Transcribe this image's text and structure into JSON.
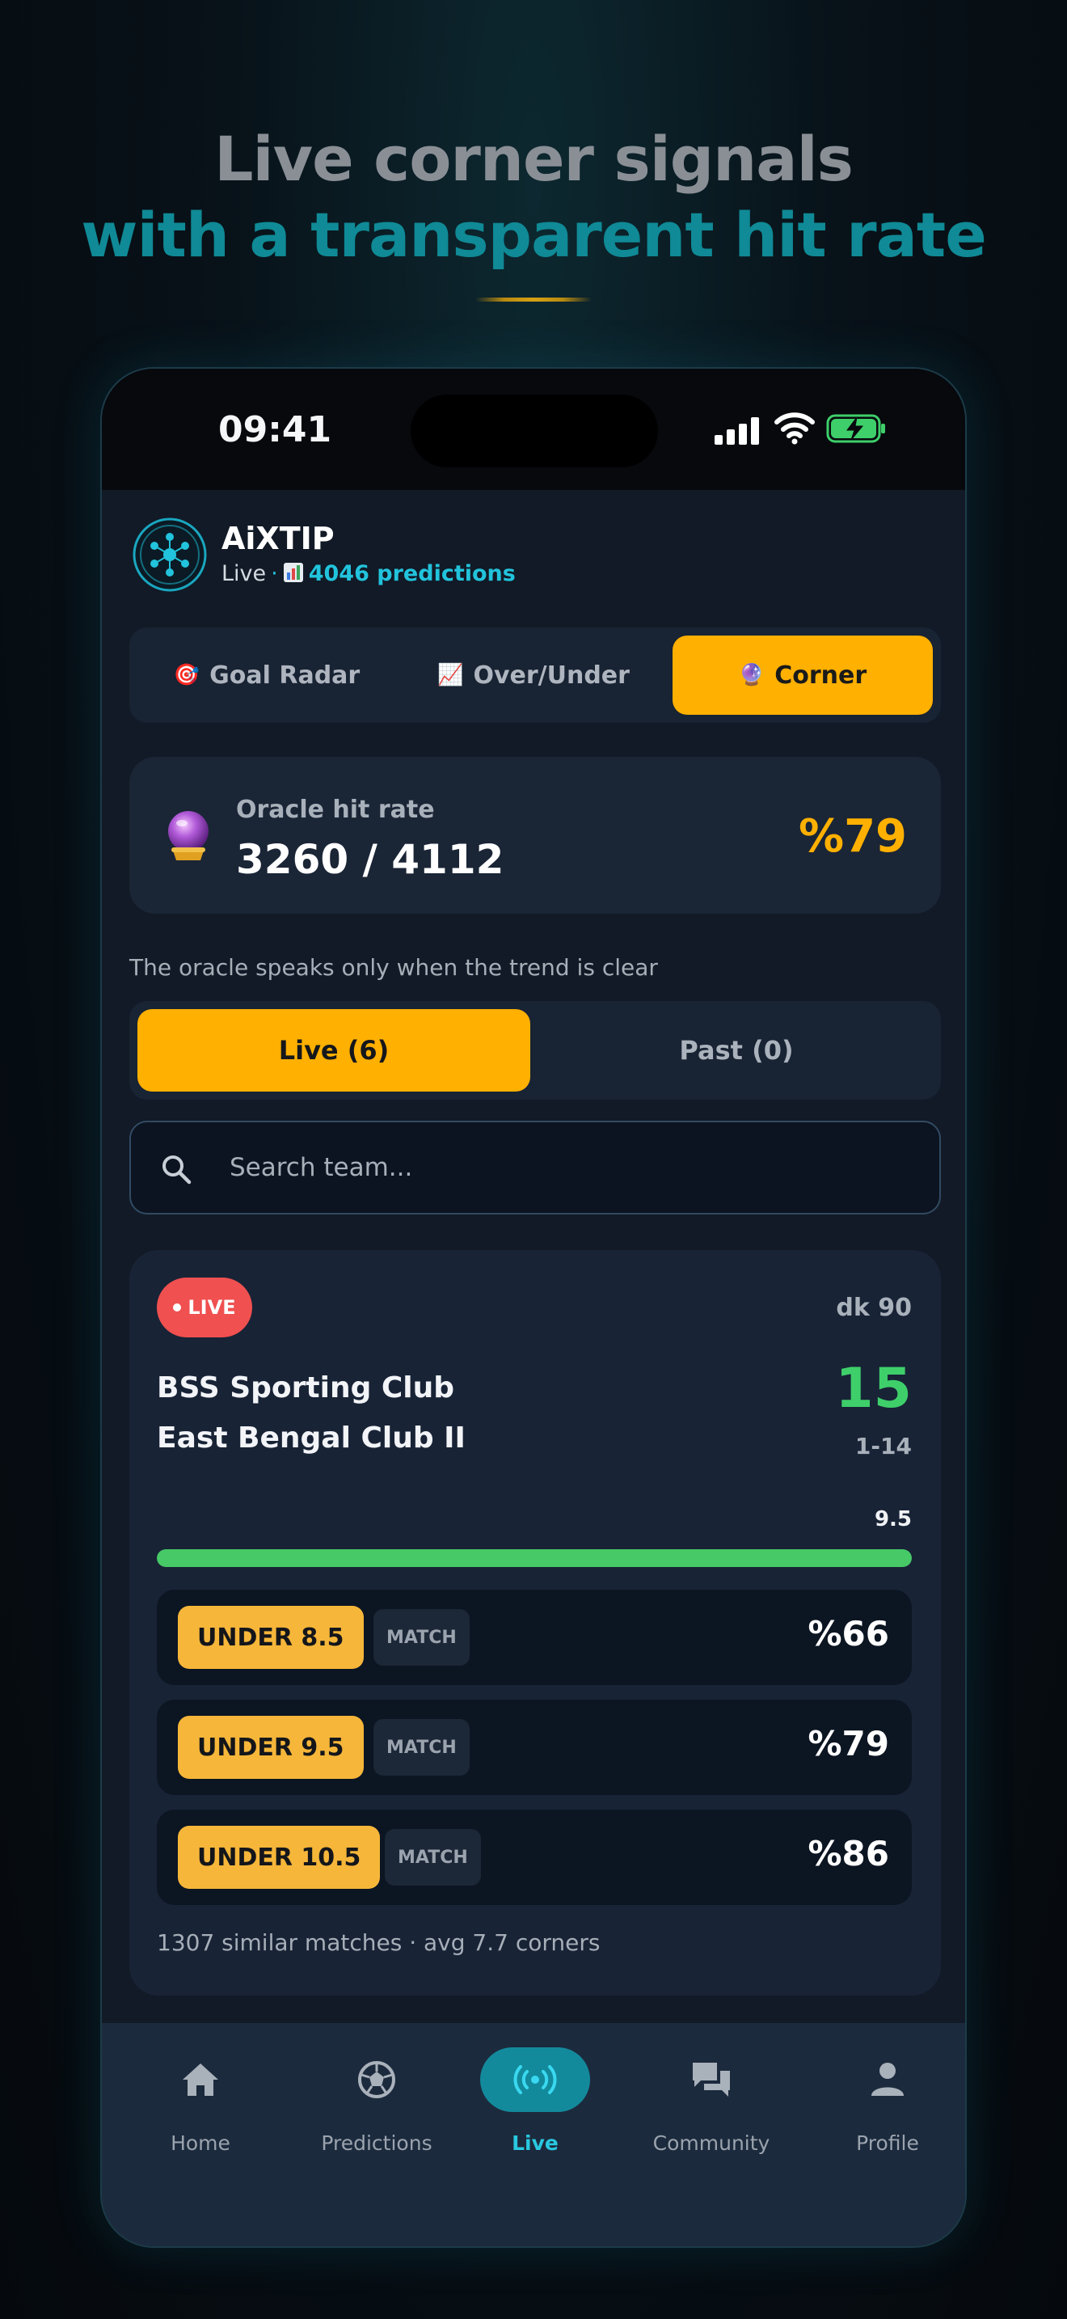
{
  "headline": {
    "line1": "Live corner signals",
    "line2": "with a transparent hit rate"
  },
  "status_bar": {
    "time": "09:41"
  },
  "brand": {
    "name": "AiXTIP",
    "status": "Live",
    "predictions": "4046 predictions",
    "accent": "#22c3dc"
  },
  "tabs": [
    {
      "label": "Goal Radar",
      "icon": "target-icon",
      "active": false
    },
    {
      "label": "Over/Under",
      "icon": "chart-up-icon",
      "active": false
    },
    {
      "label": "Corner",
      "icon": "crystal-ball-icon",
      "active": true
    }
  ],
  "hit_rate": {
    "label": "Oracle hit rate",
    "value": "3260 / 4112",
    "percent": "%79"
  },
  "tagline": "The oracle speaks only when the trend is clear",
  "filter": {
    "live_label": "Live (6)",
    "past_label": "Past (0)",
    "active": "live"
  },
  "search": {
    "placeholder": "Search team..."
  },
  "match": {
    "badge": "LIVE",
    "minute": "dk 90",
    "home": "BSS Sporting Club",
    "away": "East Bengal Club II",
    "corners": "15",
    "half_split": "1-14",
    "line": "9.5",
    "progress_fraction": 1.0,
    "picks": [
      {
        "label": "UNDER 8.5",
        "tag": "MATCH",
        "percent": "%66"
      },
      {
        "label": "UNDER 9.5",
        "tag": "MATCH",
        "percent": "%79"
      },
      {
        "label": "UNDER 10.5",
        "tag": "MATCH",
        "percent": "%86"
      }
    ],
    "similar": "1307 similar matches · avg 7.7 corners"
  },
  "nav": [
    {
      "label": "Home",
      "icon": "home-icon",
      "active": false
    },
    {
      "label": "Predictions",
      "icon": "soccer-ball-icon",
      "active": false
    },
    {
      "label": "Live",
      "icon": "broadcast-icon",
      "active": true
    },
    {
      "label": "Community",
      "icon": "chat-bubbles-icon",
      "active": false
    },
    {
      "label": "Profile",
      "icon": "person-icon",
      "active": false
    }
  ],
  "colors": {
    "accent_yellow": "#ffb000",
    "live_red": "#f05050",
    "corner_green": "#3ecf6a",
    "teal": "#138a9c"
  }
}
